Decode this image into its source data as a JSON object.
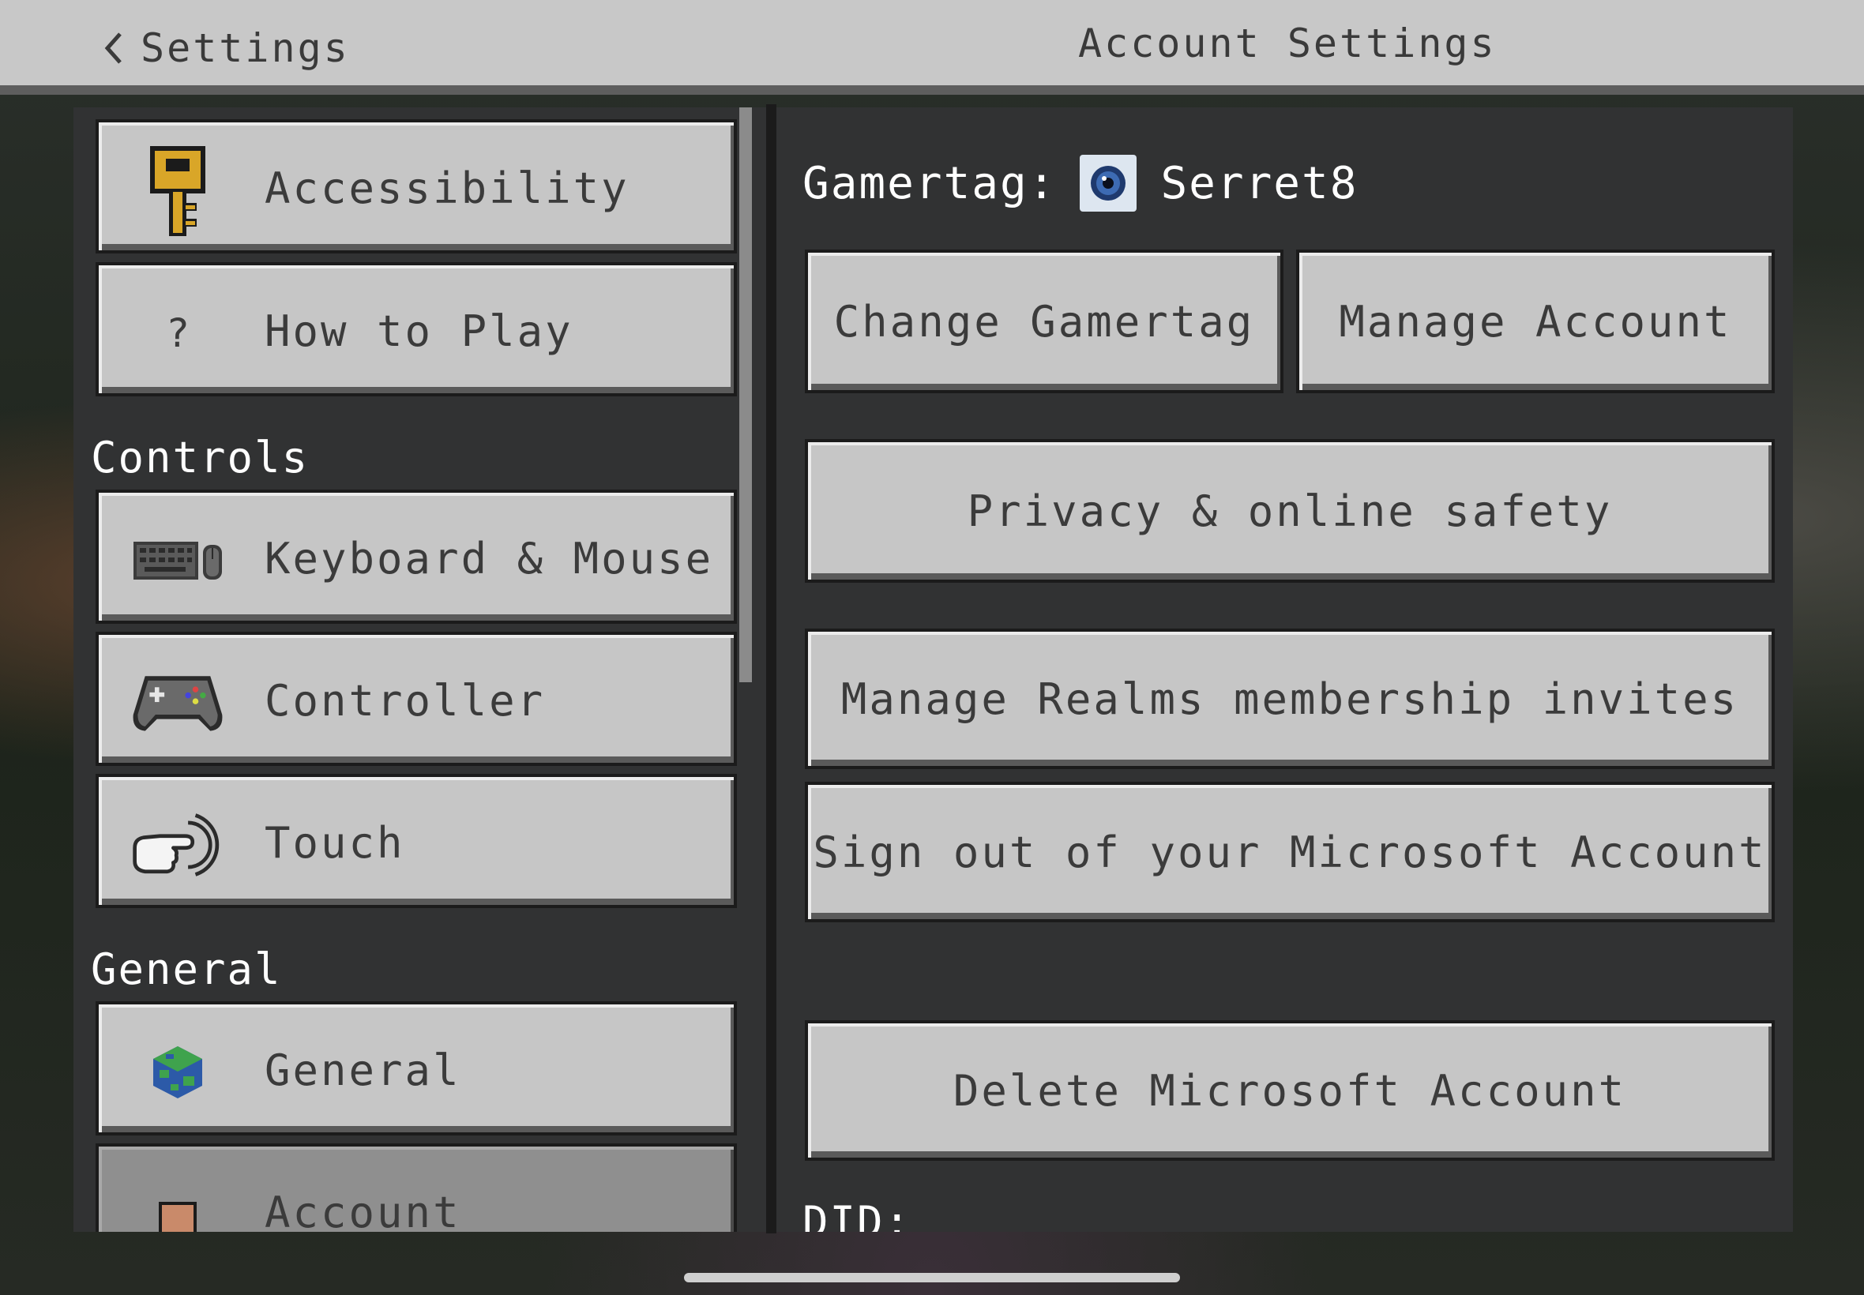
{
  "topbar": {
    "back_label": "Settings",
    "title": "Account Settings"
  },
  "sidebar": {
    "items_top": [
      {
        "label": "Accessibility",
        "icon": "key-icon"
      },
      {
        "label": "How to Play",
        "icon": "question-icon"
      }
    ],
    "sections": [
      {
        "header": "Controls",
        "items": [
          {
            "label": "Keyboard & Mouse",
            "icon": "keyboard-mouse-icon"
          },
          {
            "label": "Controller",
            "icon": "gamepad-icon"
          },
          {
            "label": "Touch",
            "icon": "touch-icon"
          }
        ]
      },
      {
        "header": "General",
        "items": [
          {
            "label": "General",
            "icon": "globe-icon"
          },
          {
            "label": "Account",
            "icon": "player-icon",
            "selected": true
          }
        ]
      }
    ]
  },
  "account": {
    "gamertag_label": "Gamertag:",
    "gamertag_value": "Serret8",
    "buttons": {
      "change_gamertag": "Change Gamertag",
      "manage_account": "Manage Account",
      "privacy": "Privacy & online safety",
      "realms": "Manage Realms membership invites",
      "sign_out": "Sign out of your Microsoft Account",
      "delete": "Delete Microsoft Account"
    },
    "did_label": "DID:"
  },
  "colors": {
    "panel": "#313233",
    "button": "#c6c6c6",
    "selected": "#8f8f8f",
    "topbar": "#c8c8c8"
  }
}
